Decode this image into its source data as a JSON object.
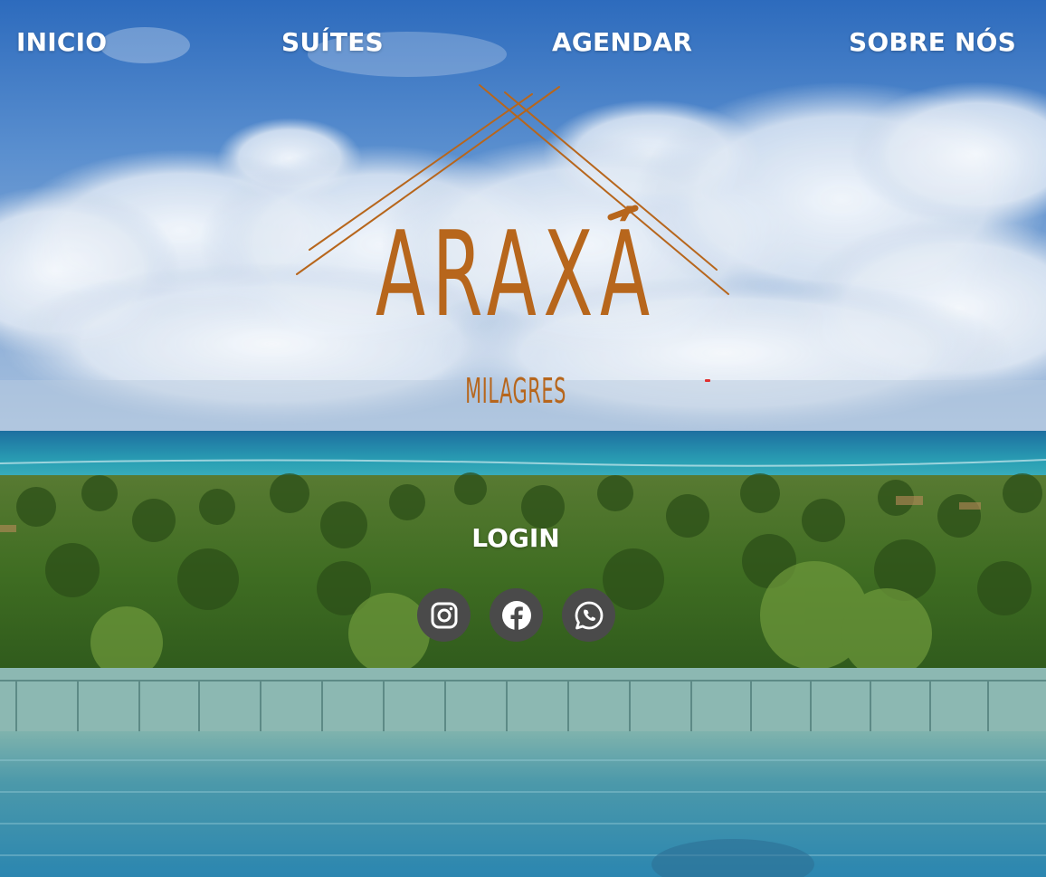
{
  "nav": {
    "items": [
      {
        "label": "INICIO"
      },
      {
        "label": "SUÍTES"
      },
      {
        "label": "AGENDAR"
      },
      {
        "label": "SOBRE NÓS"
      }
    ]
  },
  "logo": {
    "brand": "ARAXÁ",
    "subtitle": "MILAGRES",
    "color": "#b7661c"
  },
  "login": {
    "label": "LOGIN"
  },
  "socials": [
    {
      "icon": "instagram-icon"
    },
    {
      "icon": "facebook-icon"
    },
    {
      "icon": "whatsapp-icon"
    }
  ],
  "colors": {
    "nav_text": "#ffffff",
    "social_bg": "#4a4a4a",
    "brand": "#b7661c"
  }
}
